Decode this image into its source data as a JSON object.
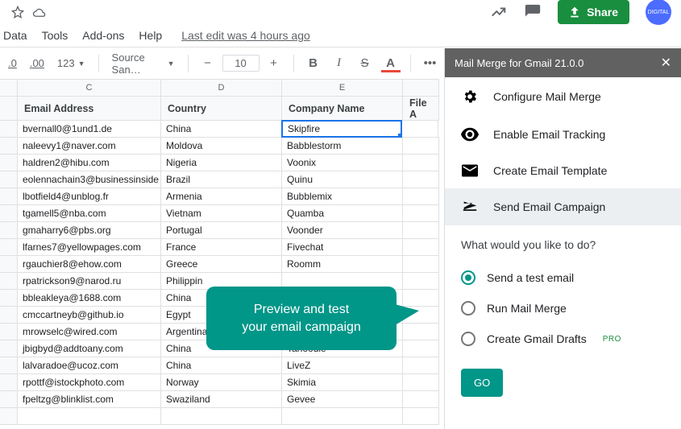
{
  "titlebar": {
    "share": "Share",
    "avatar_text": "DIGITAL"
  },
  "menubar": {
    "items": [
      "Data",
      "Tools",
      "Add-ons",
      "Help"
    ],
    "last_edit": "Last edit was 4 hours ago"
  },
  "toolbar": {
    "num_fmt": ".0",
    "num_fmt2": ".00",
    "currency": "123",
    "font": "Source San…",
    "size": "10",
    "more": "•••"
  },
  "columns": {
    "letters": [
      "C",
      "D",
      "E"
    ],
    "headers": [
      "Email Address",
      "Country",
      "Company Name",
      "File A"
    ]
  },
  "rows": [
    {
      "email": "bvernall0@1und1.de",
      "country": "China",
      "company": "Skipfire"
    },
    {
      "email": "naleevy1@naver.com",
      "country": "Moldova",
      "company": "Babblestorm"
    },
    {
      "email": "haldren2@hibu.com",
      "country": "Nigeria",
      "company": "Voonix"
    },
    {
      "email": "eolennachain3@businessinside",
      "country": "Brazil",
      "company": "Quinu"
    },
    {
      "email": "lbotfield4@unblog.fr",
      "country": "Armenia",
      "company": "Bubblemix"
    },
    {
      "email": "tgamell5@nba.com",
      "country": "Vietnam",
      "company": "Quamba"
    },
    {
      "email": "gmaharry6@pbs.org",
      "country": "Portugal",
      "company": "Voonder"
    },
    {
      "email": "lfarnes7@yellowpages.com",
      "country": "France",
      "company": "Fivechat"
    },
    {
      "email": "rgauchier8@ehow.com",
      "country": "Greece",
      "company": "Roomm"
    },
    {
      "email": "rpatrickson9@narod.ru",
      "country": "Philippin",
      "company": ""
    },
    {
      "email": "bbleakleya@1688.com",
      "country": "China",
      "company": ""
    },
    {
      "email": "cmccartneyb@github.io",
      "country": "Egypt",
      "company": ""
    },
    {
      "email": "mrowselc@wired.com",
      "country": "Argentina",
      "company": ""
    },
    {
      "email": "jbigbyd@addtoany.com",
      "country": "China",
      "company": "Tanoodle"
    },
    {
      "email": "lalvaradoe@ucoz.com",
      "country": "China",
      "company": "LiveZ"
    },
    {
      "email": "rpottf@istockphoto.com",
      "country": "Norway",
      "company": "Skimia"
    },
    {
      "email": "fpeltzg@blinklist.com",
      "country": "Swaziland",
      "company": "Gevee"
    },
    {
      "email": "",
      "country": "",
      "company": ""
    }
  ],
  "sidebar": {
    "title": "Mail Merge for Gmail 21.0.0",
    "items": [
      {
        "label": "Configure Mail Merge"
      },
      {
        "label": "Enable Email Tracking"
      },
      {
        "label": "Create Email Template"
      },
      {
        "label": "Send Email Campaign"
      }
    ],
    "question": "What would you like to do?",
    "options": [
      {
        "label": "Send a test email",
        "checked": true,
        "pro": false
      },
      {
        "label": "Run Mail Merge",
        "checked": false,
        "pro": false
      },
      {
        "label": "Create Gmail Drafts",
        "checked": false,
        "pro": true
      }
    ],
    "go": "GO",
    "pro_label": "PRO"
  },
  "callout": {
    "line1": "Preview and test",
    "line2": "your email campaign"
  }
}
